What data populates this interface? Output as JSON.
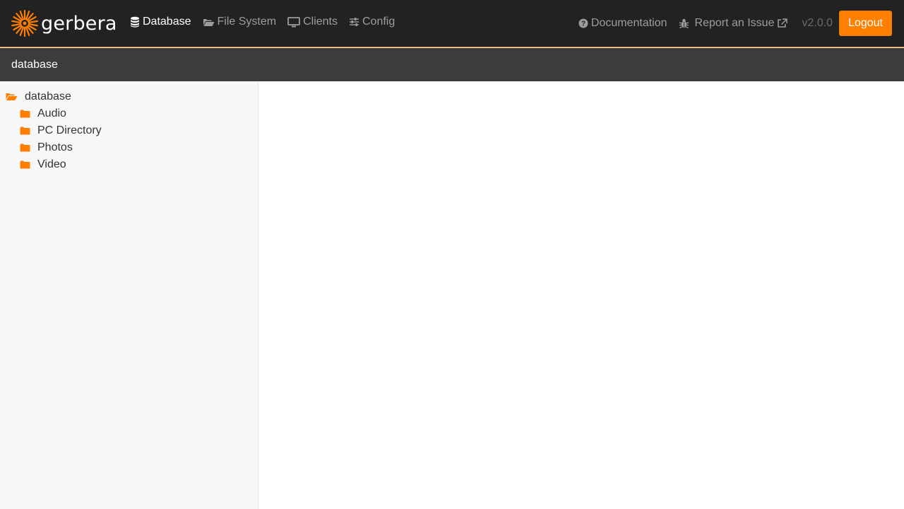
{
  "app": {
    "brand": "gerbera",
    "accent": "#ff7f00"
  },
  "nav": {
    "items": [
      {
        "label": "Database",
        "icon": "database-icon",
        "active": true
      },
      {
        "label": "File System",
        "icon": "folder-open-icon"
      },
      {
        "label": "Clients",
        "icon": "monitor-icon"
      },
      {
        "label": "Config",
        "icon": "sliders-icon"
      }
    ],
    "right": {
      "documentation": "Documentation",
      "report": "Report an Issue",
      "version": "v2.0.0",
      "logout": "Logout"
    }
  },
  "breadcrumb": "database",
  "tree": {
    "root": "database",
    "children": [
      "Audio",
      "PC Directory",
      "Photos",
      "Video"
    ]
  }
}
